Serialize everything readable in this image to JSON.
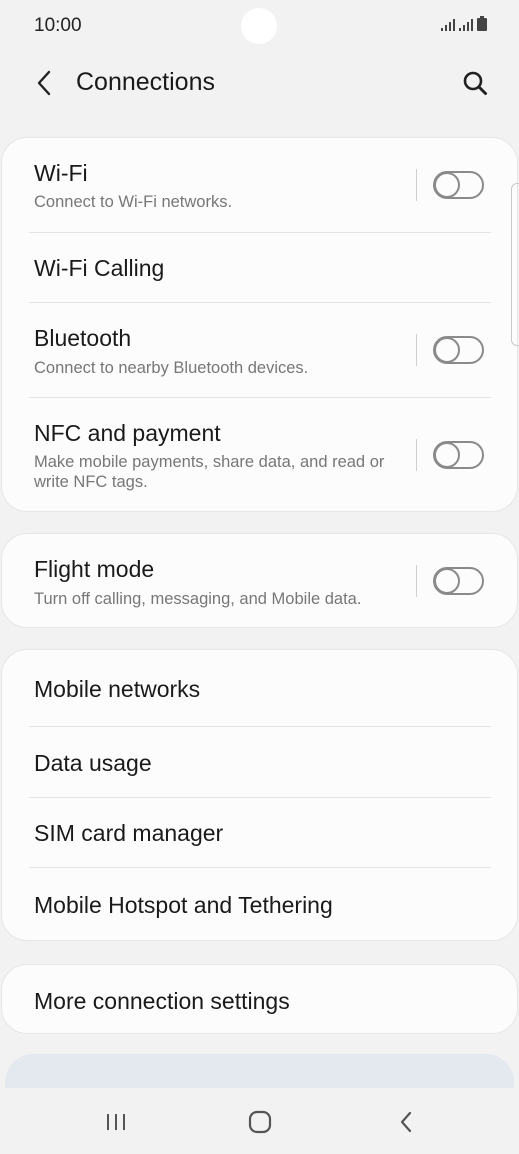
{
  "status": {
    "time": "10:00"
  },
  "header": {
    "title": "Connections"
  },
  "group1": {
    "items": [
      {
        "title": "Wi-Fi",
        "subtitle": "Connect to Wi-Fi networks.",
        "toggle": false
      },
      {
        "title": "Wi-Fi Calling"
      },
      {
        "title": "Bluetooth",
        "subtitle": "Connect to nearby Bluetooth devices.",
        "toggle": false
      },
      {
        "title": "NFC and payment",
        "subtitle": "Make mobile payments, share data, and read or write NFC tags.",
        "toggle": false
      }
    ]
  },
  "group2": {
    "items": [
      {
        "title": "Flight mode",
        "subtitle": "Turn off calling, messaging, and Mobile data.",
        "toggle": false
      }
    ]
  },
  "group3": {
    "items": [
      {
        "title": "Mobile networks"
      },
      {
        "title": "Data usage"
      },
      {
        "title": "SIM card manager"
      },
      {
        "title": "Mobile Hotspot and Tethering"
      }
    ]
  },
  "group4": {
    "items": [
      {
        "title": "More connection settings"
      }
    ]
  },
  "colors": {
    "background": "#f2f2f2",
    "card": "#fcfcfc",
    "toggle_off": "#8a8a8a"
  },
  "icons": [
    "back-arrow-icon",
    "search-icon",
    "signal-icon",
    "battery-icon",
    "recents-icon",
    "home-icon",
    "back-nav-icon"
  ]
}
